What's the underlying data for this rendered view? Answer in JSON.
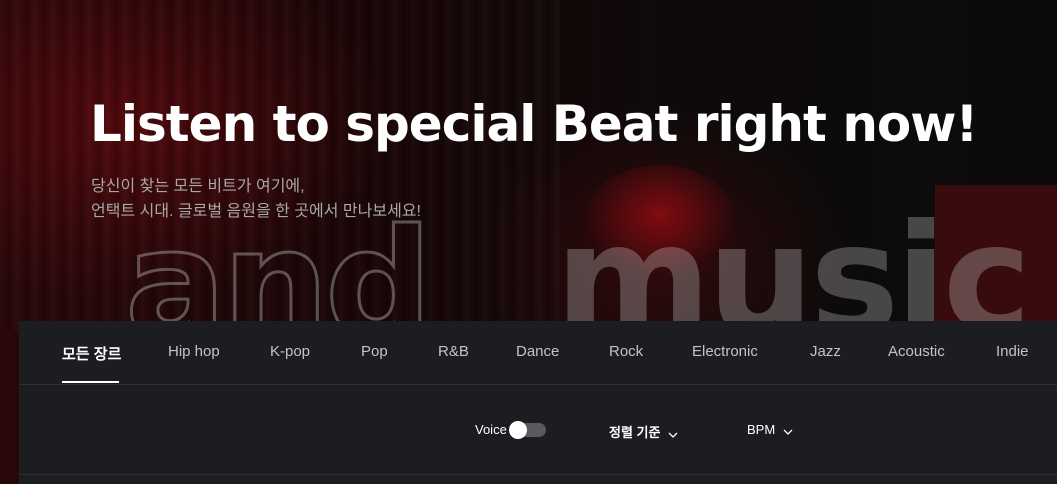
{
  "hero": {
    "title": "Listen to special Beat right now!",
    "subtitle_line1": "당신이 찾는 모든 비트가 여기에,",
    "subtitle_line2": "언택트 시대. 글로벌 음원을 한 곳에서 만나보세요!",
    "bg_word_left": "and",
    "bg_word_right": "music"
  },
  "tabs": [
    {
      "label": "모든 장르",
      "active": true
    },
    {
      "label": "Hip hop"
    },
    {
      "label": "K-pop"
    },
    {
      "label": "Pop"
    },
    {
      "label": "R&B"
    },
    {
      "label": "Dance"
    },
    {
      "label": "Rock"
    },
    {
      "label": "Electronic"
    },
    {
      "label": "Jazz"
    },
    {
      "label": "Acoustic"
    },
    {
      "label": "Indie"
    }
  ],
  "filters": {
    "voice_label": "Voice",
    "voice_on": false,
    "sort_label": "정렬 기준",
    "bpm_label": "BPM",
    "chevron_icon": "chevron-down-icon"
  },
  "colors": {
    "panel_bg": "#1c1d21",
    "active_tab": "#ffffff",
    "inactive_tab": "#c4c4c6"
  }
}
